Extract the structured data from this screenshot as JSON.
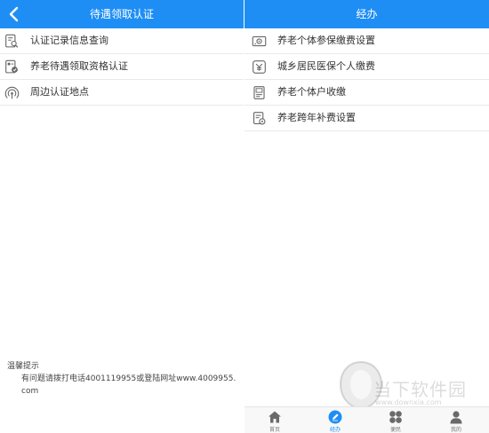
{
  "colors": {
    "accent": "#1e8ef5",
    "icon": "#666666",
    "divider": "#e9e9e9"
  },
  "left": {
    "title": "待遇领取认证",
    "back_icon": "chevron-left-icon",
    "items": [
      {
        "label": "认证记录信息查询",
        "icon": "record-search-icon"
      },
      {
        "label": "养老待遇领取资格认证",
        "icon": "certify-check-icon"
      },
      {
        "label": "周边认证地点",
        "icon": "location-signal-icon"
      }
    ],
    "tip": {
      "title": "温馨提示",
      "body": "有问题请拨打电话4001119955或登陆网址www.4009955.com"
    }
  },
  "right": {
    "title": "经办",
    "items": [
      {
        "label": "养老个体参保缴费设置",
        "icon": "settings-card-icon"
      },
      {
        "label": "城乡居民医保个人缴费",
        "icon": "medical-payment-icon"
      },
      {
        "label": "养老个体户收缴",
        "icon": "collection-icon"
      },
      {
        "label": "养老跨年补费设置",
        "icon": "cross-year-settings-icon"
      }
    ],
    "tabs": [
      {
        "label": "首页",
        "icon": "home-icon",
        "active": false
      },
      {
        "label": "经办",
        "icon": "edit-circle-icon",
        "active": true
      },
      {
        "label": "便民",
        "icon": "grid-icon",
        "active": false
      },
      {
        "label": "我的",
        "icon": "user-icon",
        "active": false
      }
    ]
  },
  "watermark": {
    "text": "当下软件园",
    "url": "www.downxia.com"
  }
}
